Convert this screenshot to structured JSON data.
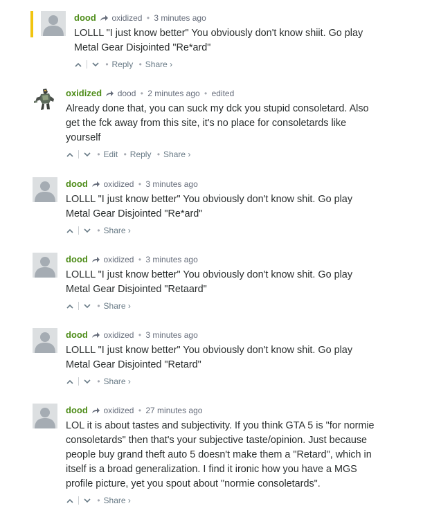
{
  "comments": [
    {
      "author": "dood",
      "parent": "oxidized",
      "time": "3 minutes ago",
      "edited": "",
      "highlighted": true,
      "avatar": "default",
      "lines": [
        "LOLLL \"I just know better\" You obviously don't know shiit. Go play",
        "Metal Gear Disjointed \"Re*ard\""
      ],
      "actions": [
        "Reply",
        "Share ›"
      ]
    },
    {
      "author": "oxidized",
      "parent": "dood",
      "time": "2 minutes ago",
      "edited": "edited",
      "highlighted": false,
      "avatar": "custom",
      "lines": [
        "Already done that, you can suck my dck you stupid consoletard. Also",
        "get the fck away from this site, it's no place for consoletards like",
        "yourself"
      ],
      "actions": [
        "Edit",
        "Reply",
        "Share ›"
      ]
    },
    {
      "author": "dood",
      "parent": "oxidized",
      "time": "3 minutes ago",
      "edited": "",
      "highlighted": false,
      "avatar": "default",
      "lines": [
        "LOLLL \"I just know better\" You obviously don't know shit. Go play",
        "Metal Gear Disjointed \"Re*ard\""
      ],
      "actions": [
        "Share ›"
      ]
    },
    {
      "author": "dood",
      "parent": "oxidized",
      "time": "3 minutes ago",
      "edited": "",
      "highlighted": false,
      "avatar": "default",
      "lines": [
        "LOLLL \"I just know better\" You obviously don't know shit. Go play",
        "Metal Gear Disjointed \"Retaard\""
      ],
      "actions": [
        "Share ›"
      ]
    },
    {
      "author": "dood",
      "parent": "oxidized",
      "time": "3 minutes ago",
      "edited": "",
      "highlighted": false,
      "avatar": "default",
      "lines": [
        "LOLLL \"I just know better\" You obviously don't know shit. Go play",
        "Metal Gear Disjointed \"Retard\""
      ],
      "actions": [
        "Share ›"
      ]
    },
    {
      "author": "dood",
      "parent": "oxidized",
      "time": "27 minutes ago",
      "edited": "",
      "highlighted": false,
      "avatar": "default",
      "lines": [
        "LOL it is about tastes and subjectivity. If you think GTA 5 is \"for normie",
        "consoletards\" then that's your subjective taste/opinion. Just because",
        "people buy grand theft auto 5 doesn't make them a \"Retard\", which in",
        "itself is a broad generalization. I find it ironic how you have a MGS",
        "profile picture, yet you spout about \"normie consoletards\"."
      ],
      "actions": [
        "Share ›"
      ]
    }
  ],
  "colors": {
    "author": "#4d8c18",
    "meta": "#656c7a",
    "text": "#2a2e2e",
    "highlight": "#f1c40f"
  },
  "icons": {
    "reply_arrow": "reply-arrow-icon",
    "upvote": "chevron-up-icon",
    "downvote": "chevron-down-icon"
  }
}
